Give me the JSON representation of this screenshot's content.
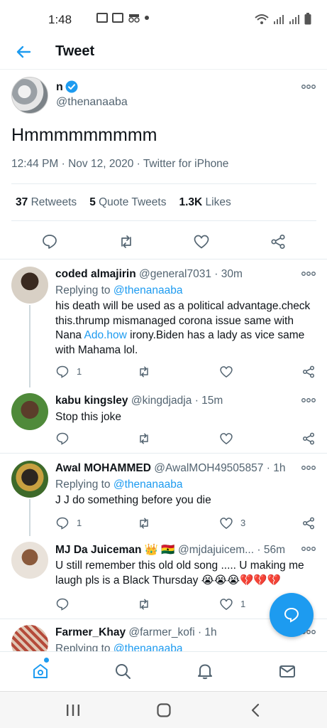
{
  "status_bar": {
    "time": "1:48"
  },
  "header": {
    "title": "Tweet"
  },
  "tweet": {
    "author_name": "n",
    "author_handle": "@thenanaaba",
    "text": "Hmmmmmmmmm",
    "meta": "12:44 PM · Nov 12, 2020 · Twitter for iPhone",
    "stats": {
      "retweets_count": "37",
      "retweets_label": "Retweets",
      "quotes_count": "5",
      "quotes_label": "Quote Tweets",
      "likes_count": "1.3K",
      "likes_label": "Likes"
    }
  },
  "replies": [
    {
      "name": "coded almajirin",
      "handle": "@general7031",
      "time": "· 30m",
      "replying_prefix": "Replying to",
      "replying_to": "@thenanaaba",
      "text_a": "his death will be used as a political advantage.check this.thrump mismanaged corona issue same with Nana ",
      "link": "Ado.how",
      "text_b": " irony.Biden has a lady as vice same with Mahama lol.",
      "reply_count": "1",
      "like_count": ""
    },
    {
      "name": "kabu kingsley",
      "handle": "@kingdjadja",
      "time": "· 15m",
      "text": "Stop this joke",
      "reply_count": "",
      "like_count": ""
    },
    {
      "name": "Awal MOHAMMED",
      "handle": "@AwalMOH49505857",
      "time": "· 1h",
      "replying_prefix": "Replying to",
      "replying_to": "@thenanaaba",
      "text": "J J do something before you die",
      "reply_count": "1",
      "like_count": "3"
    },
    {
      "name": "MJ Da Juiceman",
      "name_emoji": "👑 🇬🇭",
      "handle": "@mjdajuicem...",
      "time": "· 56m",
      "text": "U still remember this old old song ..... U making me laugh pls is a Black Thursday 😭😭😭💔💔💔",
      "reply_count": "",
      "like_count": "1"
    },
    {
      "name": "Farmer_Khay",
      "handle": "@farmer_kofi",
      "time": "· 1h",
      "replying_prefix": "Replying to",
      "replying_to": "@thenanaaba"
    }
  ],
  "colors": {
    "accent": "#1d9bf0",
    "text": "#0f1419",
    "secondary": "#536471"
  },
  "icons": {
    "back": "arrow-left-icon",
    "verified": "verified-badge-icon",
    "more": "more-horizontal-icon",
    "reply": "reply-icon",
    "retweet": "retweet-icon",
    "like": "heart-icon",
    "share": "share-icon",
    "compose": "compose-reply-icon",
    "home": "home-icon",
    "search": "search-icon",
    "notifications": "bell-icon",
    "messages": "mail-icon"
  }
}
